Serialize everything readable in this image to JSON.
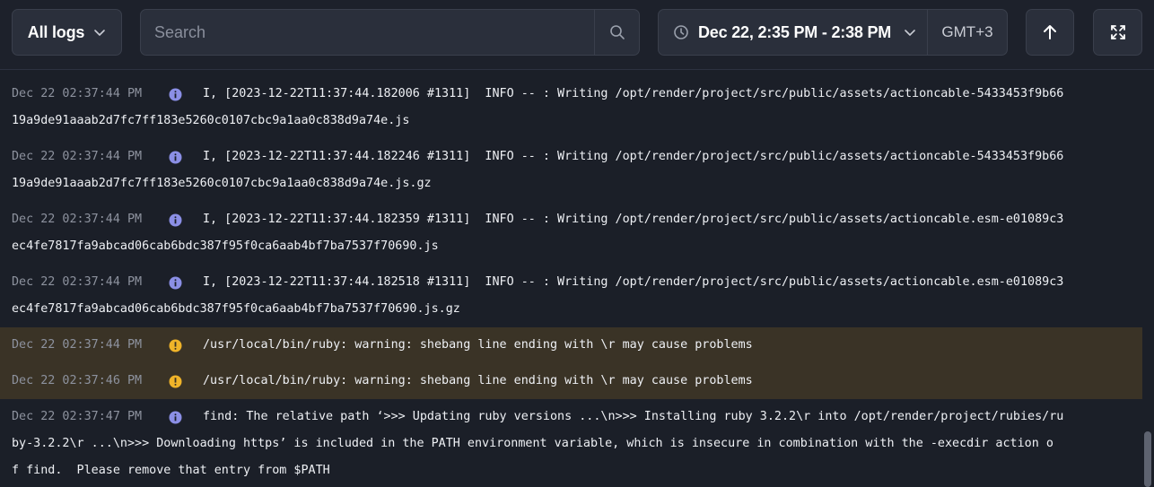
{
  "toolbar": {
    "logs_filter": "All logs",
    "search_placeholder": "Search",
    "time_range": "Dec 22, 2:35 PM - 2:38 PM",
    "timezone": "GMT+3"
  },
  "icons": {
    "chevron": "chevron-down-icon",
    "search": "search-icon",
    "clock": "clock-icon",
    "scroll_top": "arrow-up-icon",
    "fullscreen": "fullscreen-icon",
    "info": "info-icon",
    "warning": "warning-icon"
  },
  "colors": {
    "info_icon": "#8b8fe6",
    "warning_icon": "#f0b429",
    "warning_row": "#3a3326"
  },
  "logs": [
    {
      "timestamp": "Dec 22 02:37:44 PM",
      "level": "info",
      "line1": "I, [2023-12-22T11:37:44.182006 #1311]  INFO -- : Writing /opt/render/project/src/public/assets/actioncable-5433453f9b66",
      "line2": "19a9de91aaab2d7fc7ff183e5260c0107cbc9a1aa0c838d9a74e.js",
      "line3": ""
    },
    {
      "timestamp": "Dec 22 02:37:44 PM",
      "level": "info",
      "line1": "I, [2023-12-22T11:37:44.182246 #1311]  INFO -- : Writing /opt/render/project/src/public/assets/actioncable-5433453f9b66",
      "line2": "19a9de91aaab2d7fc7ff183e5260c0107cbc9a1aa0c838d9a74e.js.gz",
      "line3": ""
    },
    {
      "timestamp": "Dec 22 02:37:44 PM",
      "level": "info",
      "line1": "I, [2023-12-22T11:37:44.182359 #1311]  INFO -- : Writing /opt/render/project/src/public/assets/actioncable.esm-e01089c3",
      "line2": "ec4fe7817fa9abcad06cab6bdc387f95f0ca6aab4bf7ba7537f70690.js",
      "line3": ""
    },
    {
      "timestamp": "Dec 22 02:37:44 PM",
      "level": "info",
      "line1": "I, [2023-12-22T11:37:44.182518 #1311]  INFO -- : Writing /opt/render/project/src/public/assets/actioncable.esm-e01089c3",
      "line2": "ec4fe7817fa9abcad06cab6bdc387f95f0ca6aab4bf7ba7537f70690.js.gz",
      "line3": ""
    },
    {
      "timestamp": "Dec 22 02:37:44 PM",
      "level": "warning",
      "line1": "/usr/local/bin/ruby: warning: shebang line ending with \\r may cause problems",
      "line2": "",
      "line3": ""
    },
    {
      "timestamp": "Dec 22 02:37:46 PM",
      "level": "warning",
      "line1": "/usr/local/bin/ruby: warning: shebang line ending with \\r may cause problems",
      "line2": "",
      "line3": ""
    },
    {
      "timestamp": "Dec 22 02:37:47 PM",
      "level": "info",
      "line1": "find: The relative path ‘>>> Updating ruby versions ...\\n>>> Installing ruby 3.2.2\\r into /opt/render/project/rubies/ru",
      "line2": "by-3.2.2\\r ...\\n>>> Downloading https’ is included in the PATH environment variable, which is insecure in combination with the -execdir action o",
      "line3": "f find.  Please remove that entry from $PATH"
    }
  ]
}
